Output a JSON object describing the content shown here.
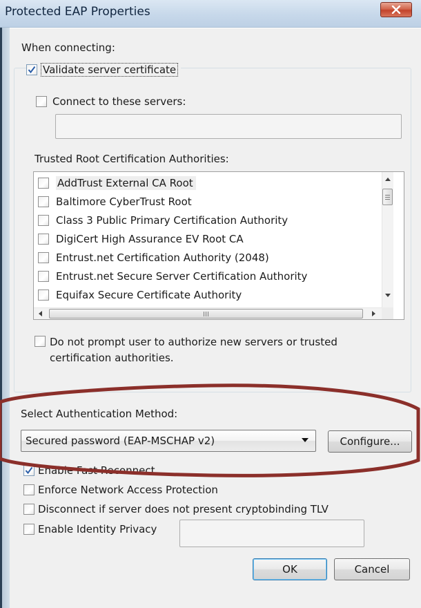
{
  "window": {
    "title": "Protected EAP Properties",
    "close_icon": "close-icon",
    "close_color": "#c8442c"
  },
  "connecting": {
    "heading": "When connecting:",
    "validate_certificate": {
      "label": "Validate server certificate",
      "checked": true
    },
    "connect_to_servers": {
      "label": "Connect to these servers:",
      "checked": false,
      "value": ""
    }
  },
  "trusted_roots": {
    "label": "Trusted Root Certification Authorities:",
    "items": [
      {
        "label": "AddTrust External CA Root",
        "checked": false
      },
      {
        "label": "Baltimore CyberTrust Root",
        "checked": false
      },
      {
        "label": "Class 3 Public Primary Certification Authority",
        "checked": false
      },
      {
        "label": "DigiCert High Assurance EV Root CA",
        "checked": false
      },
      {
        "label": "Entrust.net Certification Authority (2048)",
        "checked": false
      },
      {
        "label": "Entrust.net Secure Server Certification Authority",
        "checked": false
      },
      {
        "label": "Equifax Secure Certificate Authority",
        "checked": false
      }
    ]
  },
  "no_prompt": {
    "line1": "Do not prompt user to authorize new servers or trusted",
    "line2": "certification authorities.",
    "checked": false
  },
  "auth_method": {
    "label": "Select Authentication Method:",
    "selected": "Secured password (EAP-MSCHAP v2)",
    "configure_label": "Configure..."
  },
  "options": {
    "fast_reconnect": {
      "label": "Enable Fast Reconnect",
      "checked": true
    },
    "nap": {
      "label": "Enforce Network Access Protection",
      "checked": false
    },
    "cryptobinding": {
      "label": "Disconnect if server does not present cryptobinding TLV",
      "checked": false
    },
    "identity_privacy": {
      "label": "Enable Identity Privacy",
      "checked": false,
      "value": ""
    }
  },
  "buttons": {
    "ok": "OK",
    "cancel": "Cancel"
  },
  "colors": {
    "annotation_ellipse": "#8b2f2a",
    "check_mark": "#2a5da8"
  }
}
